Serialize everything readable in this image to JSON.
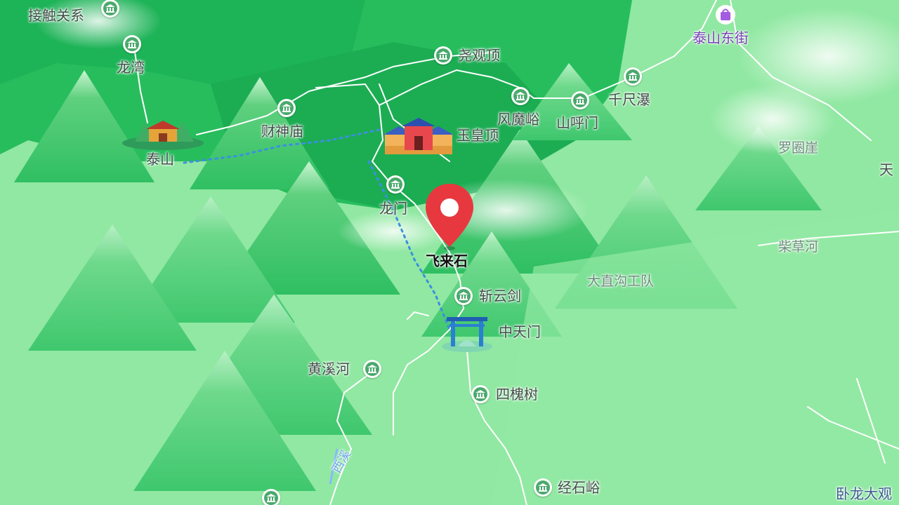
{
  "map": {
    "colors": {
      "terrain_light": "#8ee6a0",
      "terrain_mid": "#5fd07e",
      "terrain_dark": "#22b85a",
      "road": "#ffffff",
      "cable_car": "#4a90e2",
      "poi_green": "#4aa96c",
      "pin_red": "#e8383f",
      "shop_purple": "#a35be0"
    },
    "labels": {
      "contact": "接触关系",
      "longwan": "龙湾",
      "taishan": "泰山",
      "caishenmiao": "财神庙",
      "yaoguanding": "尧观顶",
      "yuhuangding": "玉皇顶",
      "fengmoyu": "风魔峪",
      "shanhumen": "山呼门",
      "qianchipu": "千尺瀑",
      "taishandongjie": "泰山东街",
      "luoquanya": "罗圈崖",
      "tian": "天",
      "longmen": "龙门",
      "feilaishi": "飞来石",
      "chaicaohe": "柴草河",
      "dazhigou": "大直沟工队",
      "zhanyunjian": "斩云剑",
      "zhongtianmen": "中天门",
      "huangxihe": "黄溪河",
      "sihuaishu": "四槐树",
      "xixi": "西溪",
      "jingshiyu": "经石峪",
      "wolongda": "卧龙大观"
    },
    "icons": {
      "poi": "museum-icon",
      "shop": "shopping-bag-icon",
      "pin": "location-pin-icon",
      "cable": "cable-car-icon"
    }
  }
}
